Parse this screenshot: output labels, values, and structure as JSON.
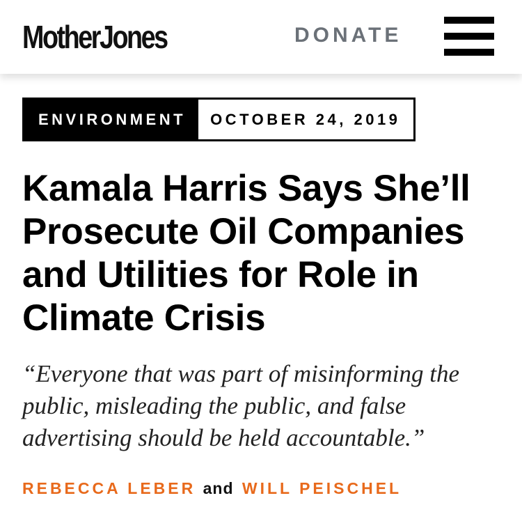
{
  "header": {
    "logo_text": "MotherJones",
    "donate_label": "DONATE",
    "menu_icon": "hamburger-menu-icon"
  },
  "article": {
    "category": "ENVIRONMENT",
    "date": "OCTOBER 24, 2019",
    "headline": "Kamala Harris Says She’ll Prosecute Oil Companies and Utilities for Role in Climate Crisis",
    "dek": "“Everyone that was part of misinforming the public, misleading the public, and false advertising should be held accountable.”",
    "byline": {
      "author_1": "REBECCA LEBER",
      "conjunction": "and",
      "author_2": "WILL PEISCHEL"
    }
  },
  "colors": {
    "author_accent": "#e86a1c",
    "donate_text": "#6b7178",
    "category_bg": "#000000"
  }
}
